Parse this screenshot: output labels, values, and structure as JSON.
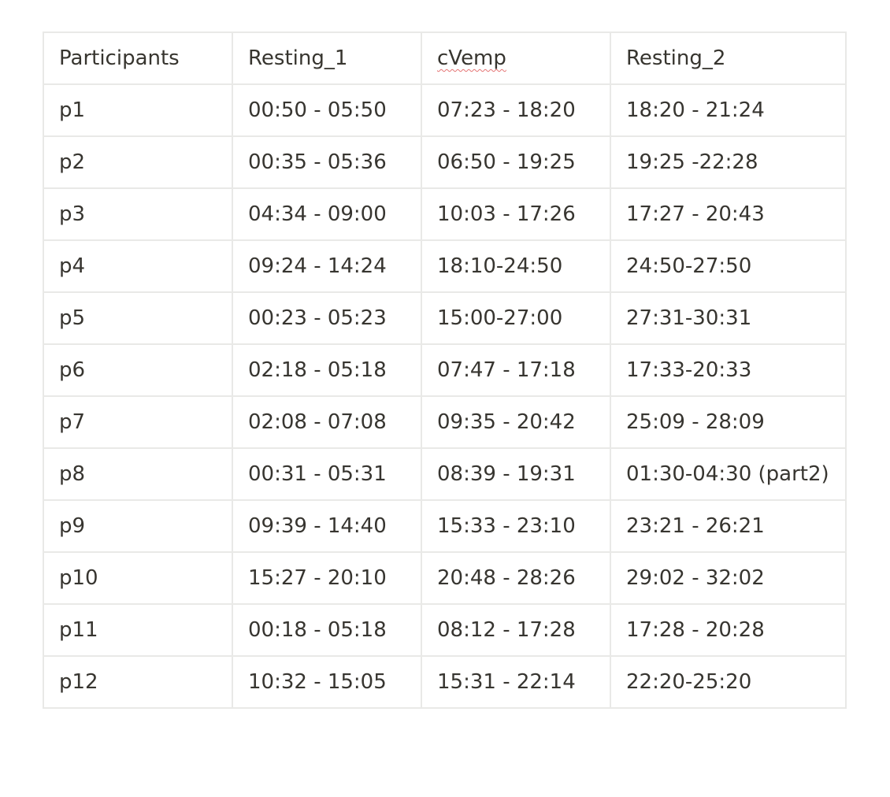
{
  "table": {
    "headers": [
      "Participants",
      "Resting_1",
      "cVemp",
      "Resting_2"
    ],
    "rows": [
      [
        "p1",
        "00:50 - 05:50",
        "07:23 - 18:20",
        "18:20 - 21:24"
      ],
      [
        "p2",
        "00:35 - 05:36",
        "06:50 - 19:25",
        "19:25 -22:28"
      ],
      [
        "p3",
        "04:34 - 09:00",
        "10:03 - 17:26",
        "17:27 - 20:43"
      ],
      [
        "p4",
        "09:24 - 14:24",
        "18:10-24:50",
        "24:50-27:50"
      ],
      [
        "p5",
        "00:23 - 05:23",
        "15:00-27:00",
        "27:31-30:31"
      ],
      [
        "p6",
        "02:18 - 05:18",
        "07:47 - 17:18",
        "17:33-20:33"
      ],
      [
        "p7",
        "02:08 - 07:08",
        "09:35 - 20:42",
        "25:09 - 28:09"
      ],
      [
        "p8",
        "00:31 - 05:31",
        "08:39 - 19:31",
        "01:30-04:30 (part2)"
      ],
      [
        "p9",
        "09:39 - 14:40",
        "15:33 - 23:10",
        "23:21 - 26:21"
      ],
      [
        "p10",
        "15:27 - 20:10",
        "20:48 - 28:26",
        "29:02 - 32:02"
      ],
      [
        "p11",
        "00:18 - 05:18",
        "08:12 - 17:28",
        "17:28 - 20:28"
      ],
      [
        "p12",
        "10:32 - 15:05",
        "15:31 - 22:14",
        "22:20-25:20"
      ]
    ]
  }
}
